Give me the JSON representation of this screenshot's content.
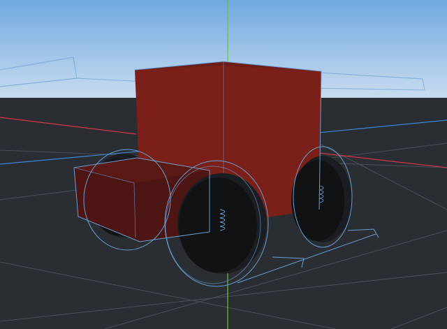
{
  "app": {
    "view": "3d-perspective-viewport",
    "object": "vehicle-model"
  },
  "colors": {
    "sky_top": "#6fa9e0",
    "sky_horizon": "#c8dcef",
    "ground": "#2a2d31",
    "grid": "#4a5058",
    "axis_x": "#d8364a",
    "axis_y": "#6bc628",
    "axis_z": "#3f86d8",
    "body_red": "#7a2019",
    "body_red_dark": "#5c1a15",
    "hood": "#4d1614",
    "wheel_rim": "#101214",
    "wheel_tire": "#1a1d21",
    "gizmo_wire": "#6a9fd6"
  },
  "scene": {
    "parts": [
      "body",
      "hood",
      "front-left-wheel",
      "rear-left-wheel",
      "rear-right-wheel",
      "spring-front",
      "spring-rear"
    ],
    "gizmos": [
      "collision-circle-front",
      "collision-circle-rear",
      "collision-circle-back",
      "bounding-box"
    ]
  }
}
